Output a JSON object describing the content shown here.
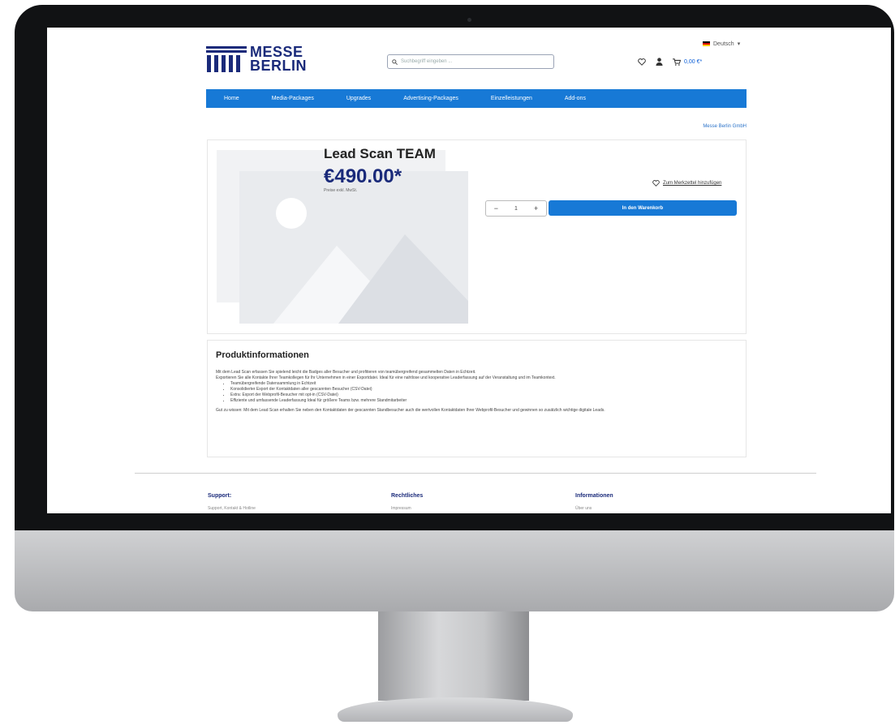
{
  "header": {
    "language": "Deutsch",
    "search_placeholder": "Suchbegriff eingeben ...",
    "cart_total": "0,00 €*",
    "logo_line1": "MESSE",
    "logo_line2": "BERLIN"
  },
  "nav": {
    "items": [
      "Home",
      "Media-Packages",
      "Upgrades",
      "Advertising-Packages",
      "Einzelleistungen",
      "Add-ons"
    ]
  },
  "breadcrumb": "Messe Berlin GmbH",
  "product": {
    "title": "Lead Scan TEAM",
    "price": "€490.00*",
    "tax_note": "Preise exkl. MwSt.",
    "wishlist_label": "Zum Merkzettel hinzufügen",
    "quantity": "1",
    "add_to_cart": "In den Warenkorb"
  },
  "info": {
    "heading": "Produktinformationen",
    "intro1": "Mit dem Lead Scan erfassen Sie spielend leicht die Badges aller Besucher und profitieren von teamübergreifend gesammelten Daten in Echtzeit.",
    "intro2": "Exportieren Sie alle Kontakte Ihrer Teamkollegen für Ihr Unternehmen in einer Exportdatei. Ideal für eine nahtlose und kooperative Leaderfassung auf der Veranstaltung und im Teamkontext.",
    "bullets": [
      "Teamübergreifende Datensammlung in Echtzeit",
      "Konsolidierter Export der Kontaktdaten aller gescannten Besucher (CSV-Datei)",
      "Extra: Export der Webprofil-Besucher mit opt-in (CSV-Datei)",
      "Effiziente und umfassende Leaderfassung Ideal für größere Teams bzw. mehrere Standmitarbeiter"
    ],
    "outro": "Gut zu wissen:  Mit dem Lead Scan erhalten Sie neben den Kontaktdaten der gescannten Standbesucher auch die wertvollen Kontaktdaten Ihrer Webprofil-Besucher und gewinnen so zusätzlich wichtige digitale Leads."
  },
  "footer": {
    "col1_title": "Support:",
    "col1_sub": "Support, Kontakt & Hotline",
    "col2_title": "Rechtliches",
    "col2_sub": "Impressum",
    "col3_title": "Informationen",
    "col3_sub": "Über uns"
  },
  "colors": {
    "brand_navy": "#1a2a7a",
    "nav_blue": "#1779d6"
  }
}
